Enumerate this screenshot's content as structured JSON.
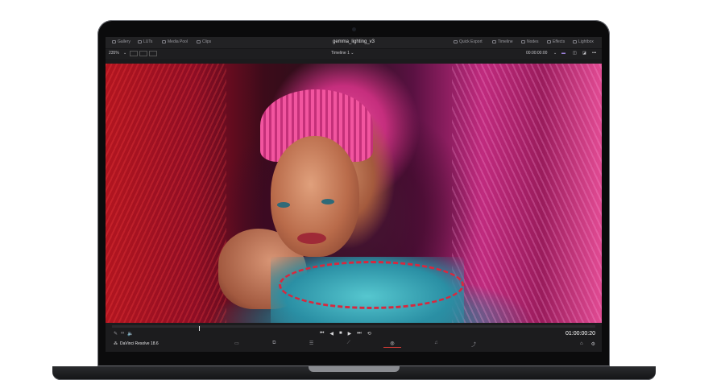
{
  "app": {
    "nav_left": [
      {
        "icon": "gallery-icon",
        "label": "Gallery"
      },
      {
        "icon": "luts-icon",
        "label": "LUTs"
      },
      {
        "icon": "media-pool-icon",
        "label": "Media Pool"
      },
      {
        "icon": "clips-icon",
        "label": "Clips"
      }
    ],
    "project_title": "gemma_lighting_v3",
    "nav_right": [
      {
        "icon": "quick-export-icon",
        "label": "Quick Export"
      },
      {
        "icon": "timeline-icon",
        "label": "Timeline"
      },
      {
        "icon": "nodes-icon",
        "label": "Nodes"
      },
      {
        "icon": "effects-icon",
        "label": "Effects"
      },
      {
        "icon": "lightbox-icon",
        "label": "Lightbox"
      }
    ]
  },
  "toolbar": {
    "zoom": "235%",
    "timeline_name": "Timeline 1",
    "source_timecode": "00:00:00:00"
  },
  "transport": {
    "buttons": [
      "⏮",
      "◀",
      "■",
      "▶",
      "⏭",
      "⟲"
    ],
    "timecode": "01:00:00:20",
    "playhead_fraction": 0.18
  },
  "footer": {
    "brand": "DaVinci Resolve 18.6",
    "pages": [
      "media-page-icon",
      "cut-page-icon",
      "edit-page-icon",
      "fusion-page-icon",
      "color-page-icon",
      "fairlight-page-icon",
      "deliver-page-icon"
    ],
    "active_page_index": 4
  }
}
